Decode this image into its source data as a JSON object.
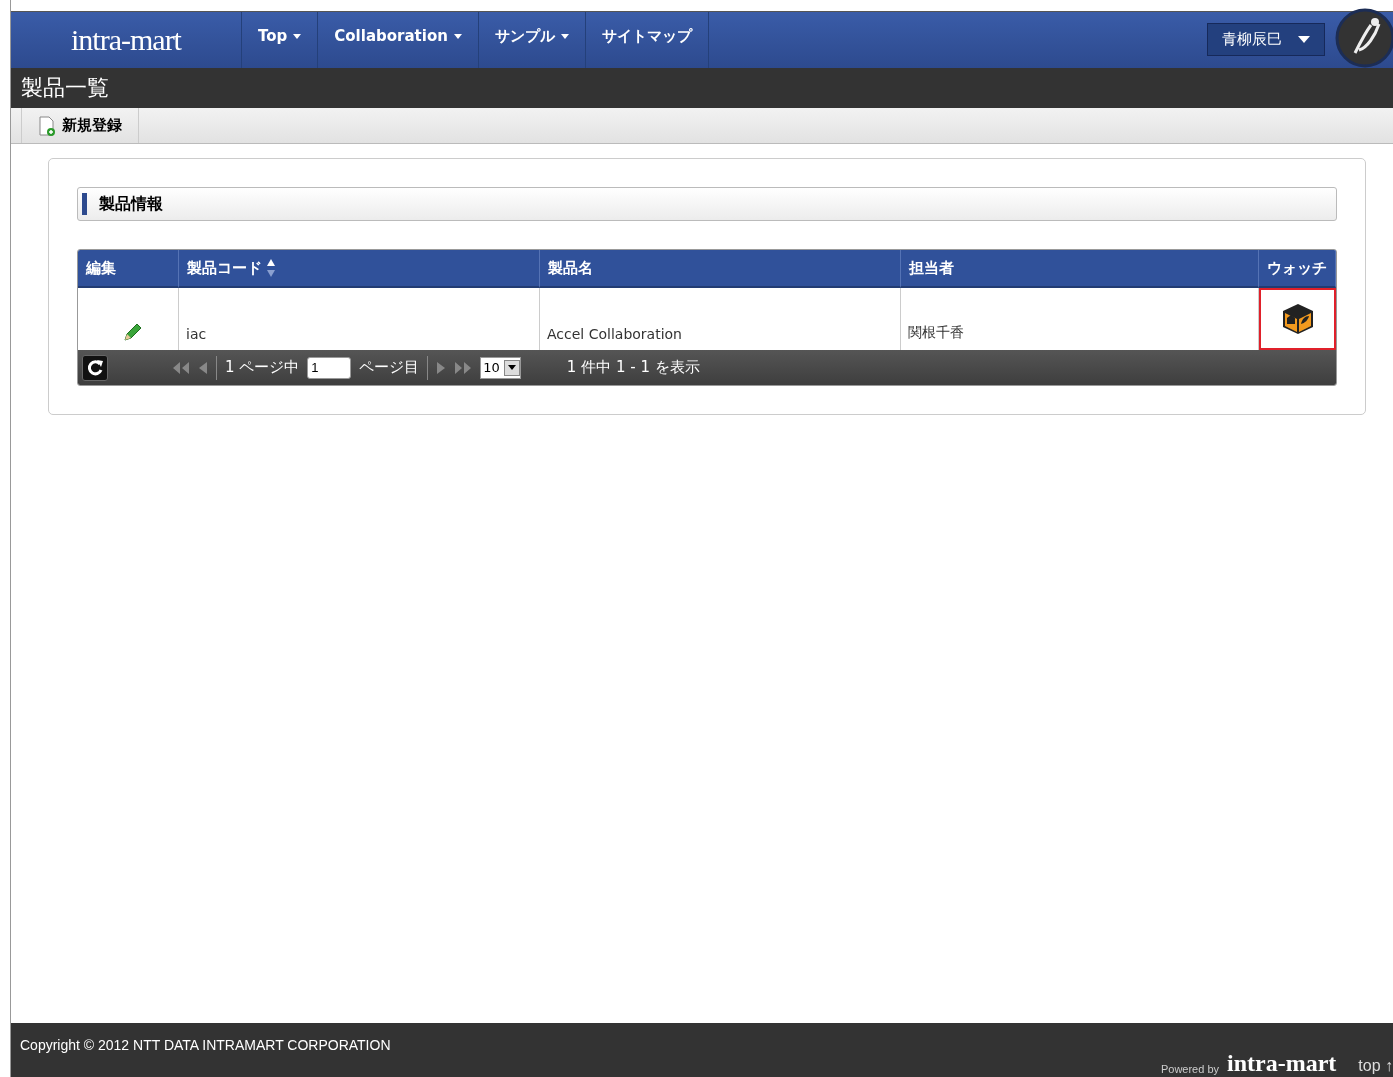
{
  "header": {
    "logo": "intra-mart",
    "menu": [
      {
        "label": "Top",
        "dropdown": true
      },
      {
        "label": "Collaboration",
        "dropdown": true
      },
      {
        "label": "サンプル",
        "dropdown": true
      },
      {
        "label": "サイトマップ",
        "dropdown": false
      }
    ],
    "user": "青柳辰巳"
  },
  "page_title": "製品一覧",
  "toolbar": {
    "buttons": [
      "新規登録"
    ]
  },
  "section": {
    "title": "製品情報"
  },
  "table": {
    "columns": [
      {
        "label": "編集",
        "sorted": false
      },
      {
        "label": "製品コード",
        "sorted": true
      },
      {
        "label": "製品名",
        "sorted": false
      },
      {
        "label": "担当者",
        "sorted": false
      },
      {
        "label": "ウォッチ",
        "sorted": false
      }
    ],
    "rows": [
      {
        "code": "iac",
        "name": "Accel Collaboration",
        "owner": "関根千香",
        "watch_highlighted": true
      }
    ]
  },
  "pager": {
    "page_of": "1 ページ中",
    "page": "1",
    "page_suffix": "ページ目",
    "page_size": "10",
    "summary": "1 件中 1 - 1 を表示",
    "first_disabled": true,
    "next_disabled": true
  },
  "footer": {
    "copyright": "Copyright © 2012 NTT DATA INTRAMART CORPORATION",
    "powered_by": "Powered by",
    "logo": "intra-mart",
    "top_link": "top ↑"
  }
}
